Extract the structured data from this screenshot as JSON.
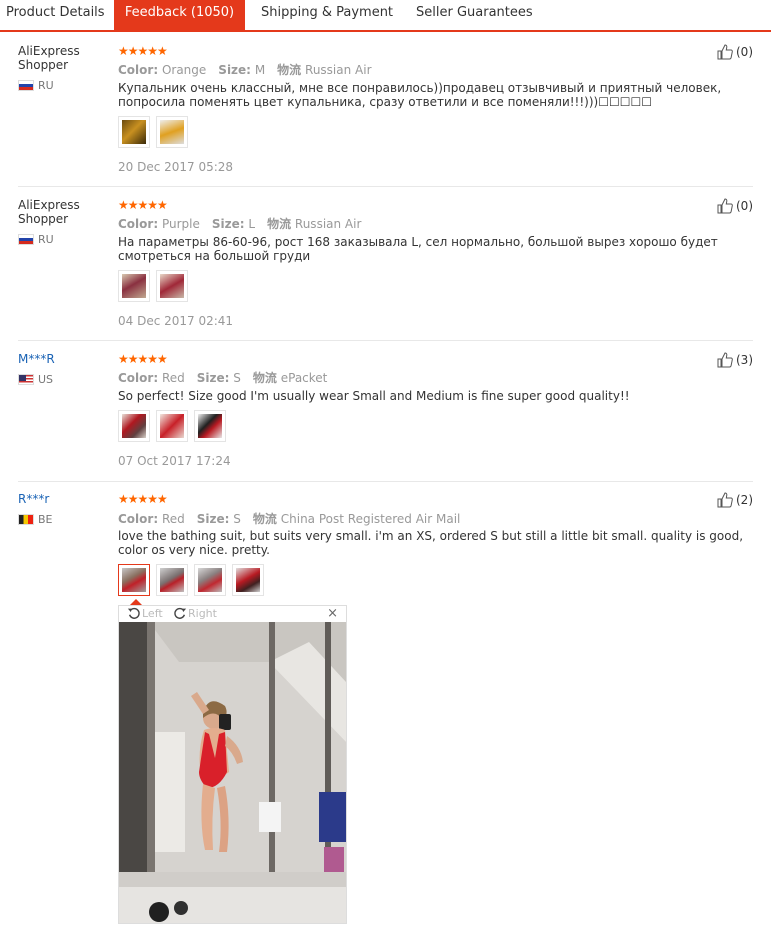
{
  "tabs": [
    "Product Details",
    "Feedback (1050)",
    "Shipping & Payment",
    "Seller Guarantees"
  ],
  "labels": {
    "color": "Color:",
    "size": "Size:",
    "shipping": "物流"
  },
  "stars": "★★★★★",
  "reviews": [
    {
      "user": "AliExpress Shopper",
      "country": "RU",
      "color": "Orange",
      "size": "M",
      "shipping": "Russian Air",
      "text": "Купальник очень классный, мне все понравилось))продавец отзывчивый и приятный человек, попросила поменять цвет купальника, сразу ответили и все поменяли!!!)))☐☐☐☐☐",
      "date": "20 Dec 2017 05:28",
      "helpful": "(0)"
    },
    {
      "user": "AliExpress Shopper",
      "country": "RU",
      "color": "Purple",
      "size": "L",
      "shipping": "Russian Air",
      "text": "На параметры 86-60-96, рост 168 заказывала L, сел нормально, большой вырез хорошо будет смотреться на большой груди",
      "date": "04 Dec 2017 02:41",
      "helpful": "(0)"
    },
    {
      "user": "M***R",
      "country": "US",
      "color": "Red",
      "size": "S",
      "shipping": "ePacket",
      "text": "So perfect! Size good I'm usually wear Small and Medium is fine super good quality!!",
      "date": "07 Oct 2017 17:24",
      "helpful": "(3)"
    },
    {
      "user": "R***r",
      "country": "BE",
      "color": "Red",
      "size": "S",
      "shipping": "China Post Registered Air Mail",
      "text": "love the bathing suit, but suits very small. i'm an XS, ordered S but still a little bit small. quality is good, color os very nice. pretty.",
      "helpful": "(2)"
    }
  ],
  "viewer": {
    "rotate_left": "Left",
    "rotate_right": "Right",
    "close": "×"
  },
  "colors": {
    "accent": "#e4391b",
    "star": "#ff6600",
    "link": "#1a63b5",
    "swimsuit_red": "#d9202a"
  }
}
